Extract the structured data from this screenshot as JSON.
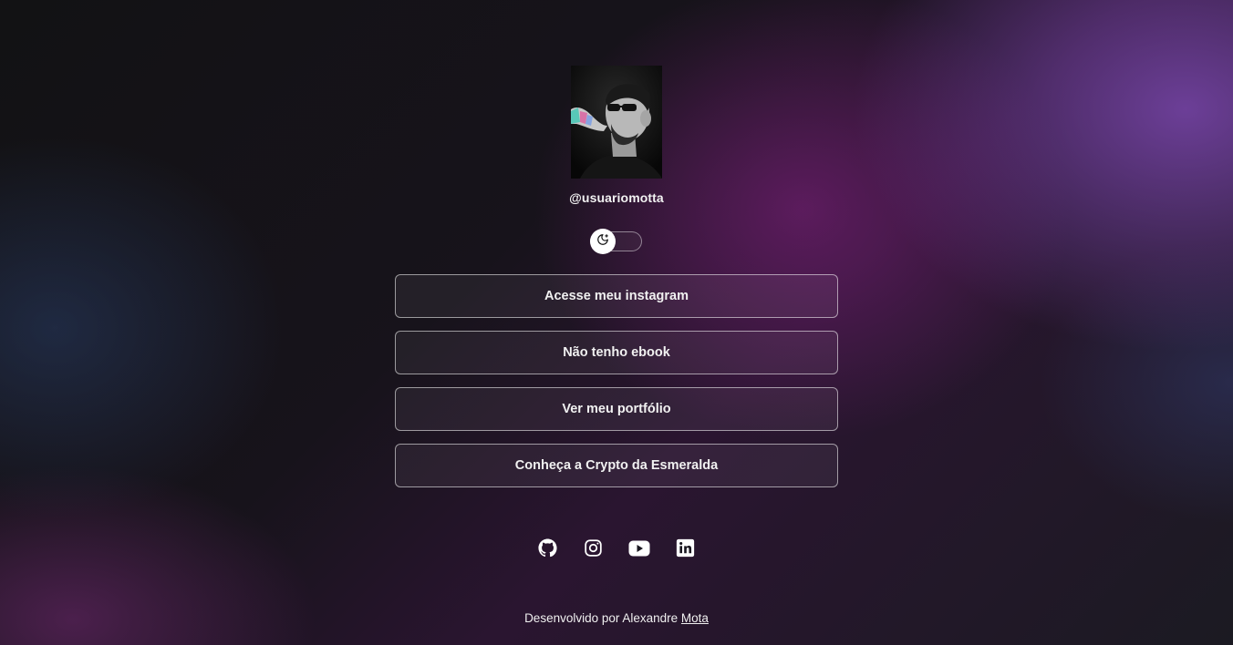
{
  "profile": {
    "username": "@usuariomotta"
  },
  "theme_toggle": {
    "icon": "moon-stars-icon",
    "state": "dark"
  },
  "links": [
    {
      "label": "Acesse meu instagram"
    },
    {
      "label": "Não tenho ebook"
    },
    {
      "label": "Ver meu portfólio"
    },
    {
      "label": "Conheça a Crypto da Esmeralda"
    }
  ],
  "social": [
    {
      "icon": "github-icon"
    },
    {
      "icon": "instagram-icon"
    },
    {
      "icon": "youtube-icon"
    },
    {
      "icon": "linkedin-icon"
    }
  ],
  "footer": {
    "text": "Desenvolvido por Alexandre ",
    "link_label": "Mota"
  },
  "colors": {
    "accent_purple": "#5e1f5f",
    "button_border": "#ffffff",
    "text": "#ffffff"
  }
}
